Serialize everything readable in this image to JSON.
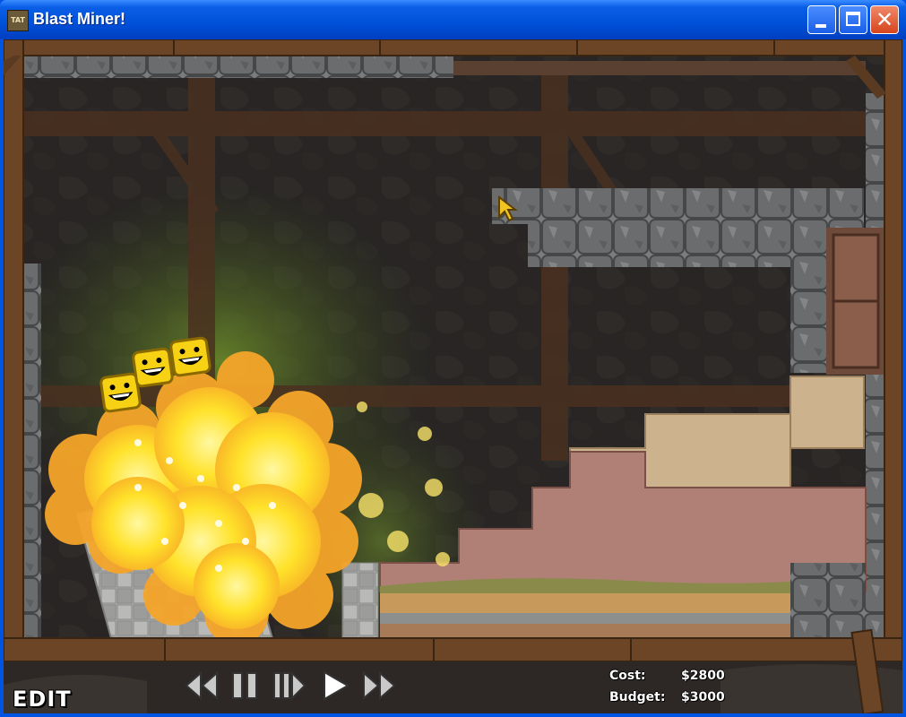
{
  "window": {
    "title": "Blast Miner!",
    "icon_text": "TAT",
    "close_glyph": "✕"
  },
  "hud": {
    "edit_label": "EDIT",
    "cost_label": "Cost:",
    "cost_value": "$2800",
    "budget_label": "Budget:",
    "budget_value": "$3000"
  },
  "icons": {
    "rewind": "rewind-icon",
    "pause": "pause-icon",
    "step": "step-forward-icon",
    "play": "play-icon",
    "fast_forward": "fast-forward-icon",
    "cursor": "arrow-cursor-icon"
  },
  "colors": {
    "frame_wood": "#6b4526",
    "cave_dark": "#2a2624",
    "stone": "#6d6f70",
    "dirt_pink": "#b08077",
    "sand": "#cdb28e",
    "explosion": "#ffe030",
    "miner_yellow": "#f7d214"
  },
  "miners": [
    {
      "name": "miner-1"
    },
    {
      "name": "miner-2"
    },
    {
      "name": "miner-3"
    }
  ]
}
